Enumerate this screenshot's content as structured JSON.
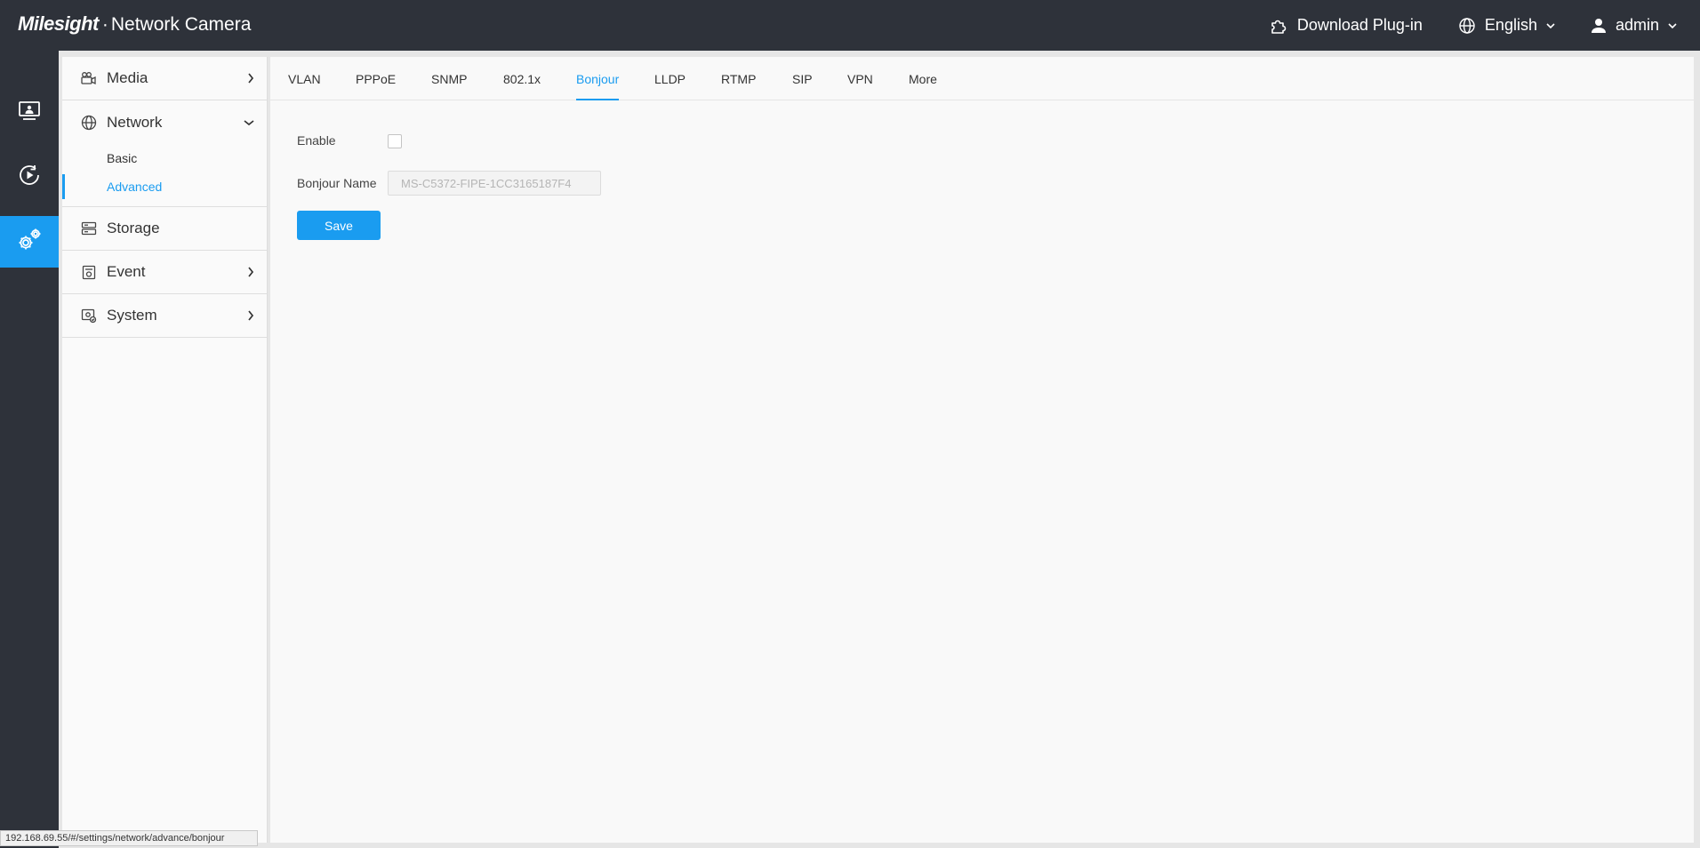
{
  "header": {
    "brand_logo": "Milesight",
    "brand_separator": "·",
    "brand_title": "Network Camera",
    "download_plugin": "Download Plug-in",
    "language": "English",
    "user": "admin"
  },
  "rail": {
    "items": [
      {
        "name": "live-view",
        "icon": "monitor-icon"
      },
      {
        "name": "playback",
        "icon": "play-circle-icon"
      },
      {
        "name": "settings",
        "icon": "gear-icon"
      }
    ]
  },
  "sidebar": {
    "media": "Media",
    "network": "Network",
    "network_sub": [
      "Basic",
      "Advanced"
    ],
    "storage": "Storage",
    "event": "Event",
    "system": "System"
  },
  "tabs": [
    "VLAN",
    "PPPoE",
    "SNMP",
    "802.1x",
    "Bonjour",
    "LLDP",
    "RTMP",
    "SIP",
    "VPN",
    "More"
  ],
  "active_tab": "Bonjour",
  "form": {
    "enable_label": "Enable",
    "enable_checked": false,
    "name_label": "Bonjour Name",
    "name_value": "MS-C5372-FIPE-1CC3165187F4",
    "save_label": "Save"
  },
  "status_url": "192.168.69.55/#/settings/network/advance/bonjour",
  "colors": {
    "accent": "#1a9cf0",
    "topbar": "#2e323a"
  }
}
